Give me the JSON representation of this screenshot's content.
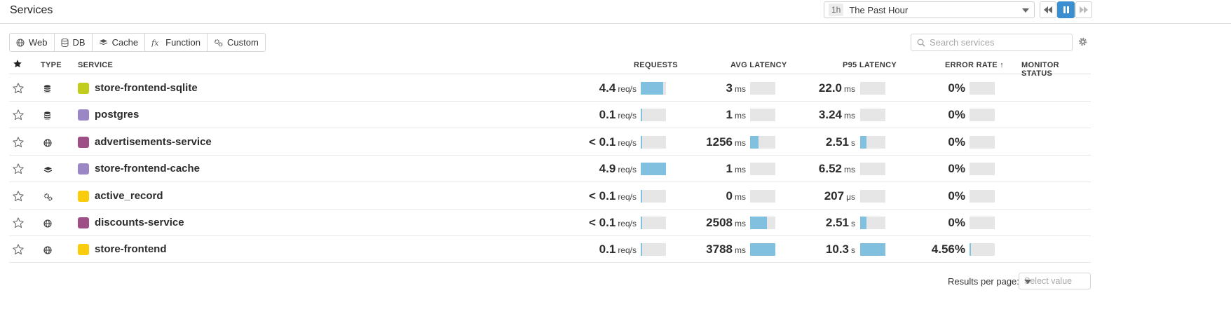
{
  "header": {
    "title": "Services",
    "time_range": {
      "badge": "1h",
      "label": "The Past Hour"
    }
  },
  "filters": [
    {
      "label": "Web",
      "icon": "globe-icon"
    },
    {
      "label": "DB",
      "icon": "database-icon"
    },
    {
      "label": "Cache",
      "icon": "layers-icon"
    },
    {
      "label": "Function",
      "icon": "function-icon"
    },
    {
      "label": "Custom",
      "icon": "gears-icon"
    }
  ],
  "search": {
    "placeholder": "Search services"
  },
  "table": {
    "columns": {
      "type": "TYPE",
      "service": "SERVICE",
      "requests": "REQUESTS",
      "avg_latency": "AVG LATENCY",
      "p95_latency": "P95 LATENCY",
      "error_rate": "ERROR RATE ↑",
      "monitor_status": "MONITOR STATUS"
    },
    "rows": [
      {
        "type": "database-icon",
        "color": "#c1cc1b",
        "name": "store-frontend-sqlite",
        "requests": "4.4",
        "requests_unit": "req/s",
        "requests_fill": 0.88,
        "avg": "3",
        "avg_unit": "ms",
        "avg_fill": 0,
        "p95": "22.0",
        "p95_unit": "ms",
        "p95_fill": 0,
        "error": "0%",
        "error_fill": 0
      },
      {
        "type": "database-icon",
        "color": "#9b87c6",
        "name": "postgres",
        "requests": "0.1",
        "requests_unit": "req/s",
        "requests_fill": 0.03,
        "avg": "1",
        "avg_unit": "ms",
        "avg_fill": 0,
        "p95": "3.24",
        "p95_unit": "ms",
        "p95_fill": 0,
        "error": "0%",
        "error_fill": 0
      },
      {
        "type": "globe-icon",
        "color": "#9e4f86",
        "name": "advertisements-service",
        "requests": "< 0.1",
        "requests_unit": "req/s",
        "requests_fill": 0.03,
        "avg": "1256",
        "avg_unit": "ms",
        "avg_fill": 0.33,
        "p95": "2.51",
        "p95_unit": "s",
        "p95_fill": 0.24,
        "error": "0%",
        "error_fill": 0
      },
      {
        "type": "layers-icon",
        "color": "#9b87c6",
        "name": "store-frontend-cache",
        "requests": "4.9",
        "requests_unit": "req/s",
        "requests_fill": 1.0,
        "avg": "1",
        "avg_unit": "ms",
        "avg_fill": 0,
        "p95": "6.52",
        "p95_unit": "ms",
        "p95_fill": 0,
        "error": "0%",
        "error_fill": 0
      },
      {
        "type": "gears-icon",
        "color": "#f9cd0b",
        "name": "active_record",
        "requests": "< 0.1",
        "requests_unit": "req/s",
        "requests_fill": 0.03,
        "avg": "0",
        "avg_unit": "ms",
        "avg_fill": 0,
        "p95": "207",
        "p95_unit": "μs",
        "p95_fill": 0,
        "error": "0%",
        "error_fill": 0
      },
      {
        "type": "globe-icon",
        "color": "#9e4f86",
        "name": "discounts-service",
        "requests": "< 0.1",
        "requests_unit": "req/s",
        "requests_fill": 0.03,
        "avg": "2508",
        "avg_unit": "ms",
        "avg_fill": 0.66,
        "p95": "2.51",
        "p95_unit": "s",
        "p95_fill": 0.24,
        "error": "0%",
        "error_fill": 0
      },
      {
        "type": "globe-icon",
        "color": "#f9cd0b",
        "name": "store-frontend",
        "requests": "0.1",
        "requests_unit": "req/s",
        "requests_fill": 0.03,
        "avg": "3788",
        "avg_unit": "ms",
        "avg_fill": 1.0,
        "p95": "10.3",
        "p95_unit": "s",
        "p95_fill": 1.0,
        "error": "4.56%",
        "error_fill": 0.04
      }
    ]
  },
  "footer": {
    "results_label": "Results per page:",
    "select_placeholder": "Select value"
  },
  "colors": {
    "accent": "#3b8fd0",
    "bar_fill": "#82c0e0",
    "bar_track": "#e6e6e7"
  }
}
